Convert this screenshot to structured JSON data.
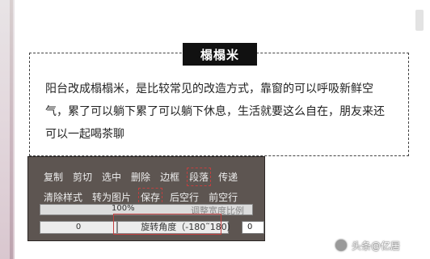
{
  "title": "榻榻米",
  "paragraph": "阳台改成榻榻米，是比较常见的改造方式，靠窗的可以呼吸新鲜空气，累了可以躺下累了可以躺下休息，生活就要这么自在，朋友来还可以一起喝茶聊",
  "toolbar": {
    "row1": [
      "复制",
      "剪切",
      "选中",
      "删除",
      "边框",
      "段落",
      "传递"
    ],
    "row2": [
      "清除样式",
      "转为图片",
      "保存",
      "后空行",
      "前空行"
    ]
  },
  "width_ratio": {
    "value_text": "100%",
    "value": 1.0,
    "label": "调整宽度比例"
  },
  "rotate": {
    "left_value": "0",
    "label": "旋转角度（-180˜180）",
    "right_value": "0"
  },
  "watermark": "头条@亿居"
}
